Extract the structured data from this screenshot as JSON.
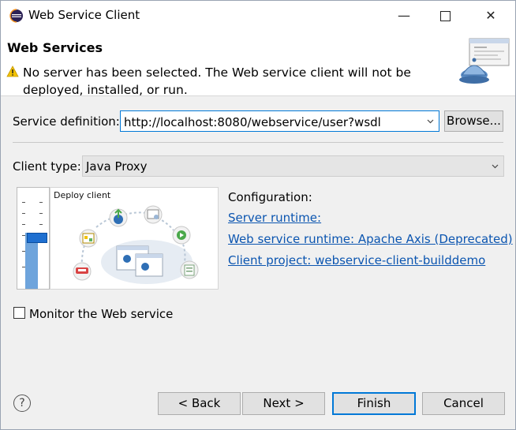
{
  "window": {
    "title": "Web Service Client"
  },
  "banner": {
    "title": "Web Services",
    "message": "No server has been selected. The Web service client will not be deployed, installed, or run."
  },
  "service_definition": {
    "label": "Service definition:",
    "value": "http://localhost:8080/webservice/user?wsdl",
    "browse_label": "Browse..."
  },
  "client_type": {
    "label": "Client type:",
    "value": "Java Proxy"
  },
  "preview": {
    "label": "Deploy client",
    "slider_level": 0.45
  },
  "configuration": {
    "title": "Configuration:",
    "server_runtime": "Server runtime: ",
    "ws_runtime": "Web service runtime: Apache Axis (Deprecated)",
    "client_project": "Client project: webservice-client-builddemo"
  },
  "monitor": {
    "label": "Monitor the Web service",
    "checked": false
  },
  "buttons": {
    "back": "< Back",
    "next": "Next >",
    "finish": "Finish",
    "cancel": "Cancel"
  },
  "colors": {
    "accent": "#0078d7",
    "link": "#0b55b0",
    "slider_fill": "#6ea4dc"
  }
}
